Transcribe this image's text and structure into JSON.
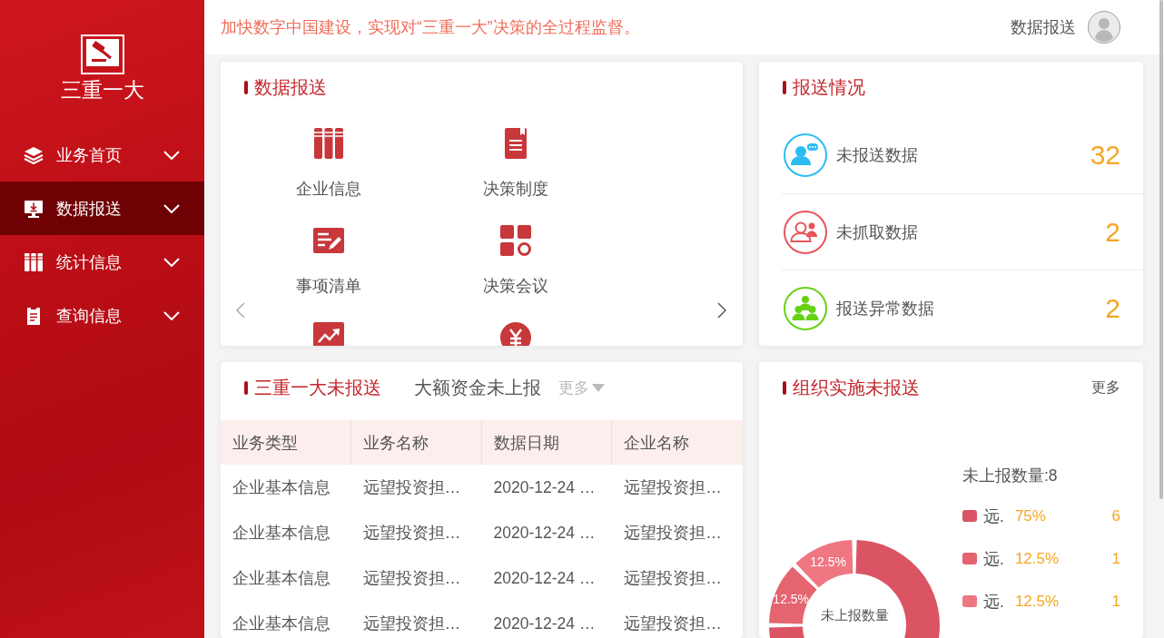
{
  "header": {
    "slogan": "加快数字中国建设，实现对“三重一大”决策的全过程监督。",
    "user_label": "数据报送"
  },
  "sidebar": {
    "logo_text": "三重一大",
    "items": [
      {
        "label": "业务首页",
        "selected": false
      },
      {
        "label": "数据报送",
        "selected": true
      },
      {
        "label": "统计信息",
        "selected": false
      },
      {
        "label": "查询信息",
        "selected": false
      }
    ]
  },
  "report_card": {
    "title": "数据报送",
    "tiles": [
      {
        "label": "企业信息",
        "partial": false
      },
      {
        "label": "决策制度",
        "partial": false
      },
      {
        "label": "事项清单",
        "partial": false
      },
      {
        "label": "决策会议",
        "partial": false
      },
      {
        "partial": true
      },
      {
        "partial": true
      }
    ]
  },
  "status_card": {
    "title": "报送情况",
    "rows": [
      {
        "label": "未报送数据",
        "count": "32",
        "color": "#2bbdf2"
      },
      {
        "label": "未抓取数据",
        "count": "2",
        "color": "#e8545c"
      },
      {
        "label": "报送异常数据",
        "count": "2",
        "color": "#66d214"
      }
    ]
  },
  "pending_card": {
    "tabs": [
      {
        "label": "三重一大未报送",
        "selected": true
      },
      {
        "label": "大额资金未上报",
        "selected": false
      }
    ],
    "more": "更多",
    "table": {
      "columns": [
        "业务类型",
        "业务名称",
        "数据日期",
        "企业名称"
      ],
      "rows": [
        [
          "企业基本信息",
          "远望投资担…",
          "2020-12-24 …",
          "远望投资担…"
        ],
        [
          "企业基本信息",
          "远望投资担…",
          "2020-12-24 …",
          "远望投资担…"
        ],
        [
          "企业基本信息",
          "远望投资担…",
          "2020-12-24 …",
          "远望投资担…"
        ],
        [
          "企业基本信息",
          "远望投资担…",
          "2020-12-24 …",
          "远望投资担…"
        ]
      ]
    }
  },
  "org_card": {
    "title": "组织实施未报送",
    "more": "更多",
    "center_label": "未上报数量",
    "chart_data": {
      "type": "donut",
      "values": [
        75,
        12.5,
        12.5
      ],
      "value_labels": [
        null,
        "12.5%",
        "12.5%"
      ]
    },
    "legend": {
      "total": "未上报数量:8",
      "items": [
        {
          "name": "远.",
          "percent": "75%",
          "count": "6",
          "color": "#db5463"
        },
        {
          "name": "远.",
          "percent": "12.5%",
          "count": "1",
          "color": "#e4646f"
        },
        {
          "name": "远.",
          "percent": "12.5%",
          "count": "1",
          "color": "#ee7782"
        }
      ]
    }
  }
}
